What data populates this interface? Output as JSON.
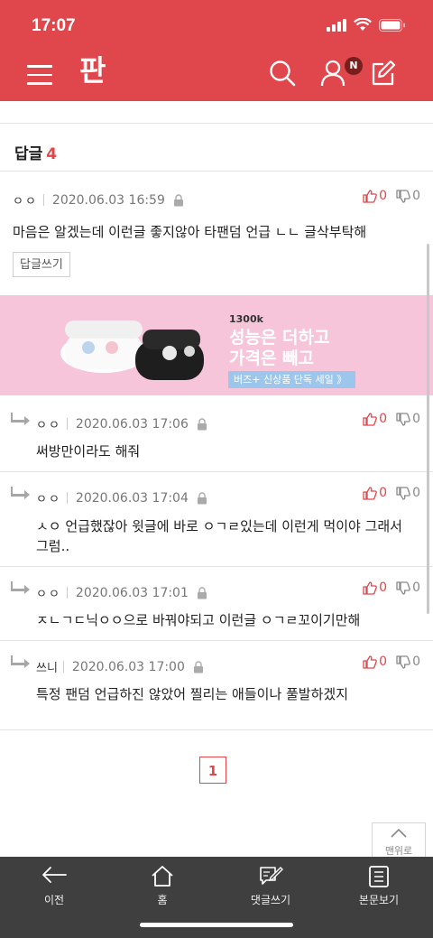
{
  "status": {
    "time": "17:07"
  },
  "header": {
    "logo": "판",
    "notification_badge": "N",
    "accent": "#e0474c"
  },
  "section": {
    "title": "답글",
    "count": "4"
  },
  "comment": {
    "author": "ㅇㅇ",
    "date": "2020.06.03 16:59",
    "likes": "0",
    "dislikes": "0",
    "text": "마음은 알겠는데 이런글 좋지않아 타팬덤 언급 ㄴㄴ 글삭부탁해",
    "reply_button": "답글쓰기"
  },
  "ad": {
    "brand": "1300k",
    "headline_line1": "성능은 더하고",
    "headline_line2": "가격은 빼고",
    "tag": "버즈+ 신상품 단독 세일 》"
  },
  "replies": [
    {
      "author": "ㅇㅇ",
      "date": "2020.06.03 17:06",
      "likes": "0",
      "dislikes": "0",
      "text": "써방만이라도 해줘"
    },
    {
      "author": "ㅇㅇ",
      "date": "2020.06.03 17:04",
      "likes": "0",
      "dislikes": "0",
      "text": "ㅅㅇ 언급했잖아 윗글에 바로 ㅇㄱㄹ있는데 이런게 먹이야 그래서 그럼.."
    },
    {
      "author": "ㅇㅇ",
      "date": "2020.06.03 17:01",
      "likes": "0",
      "dislikes": "0",
      "text": "ㅈㄴㄱㄷ닉ㅇㅇ으로 바꿔야되고 이런글 ㅇㄱㄹ꼬이기만해"
    },
    {
      "author": "쓰니",
      "date": "2020.06.03 17:00",
      "likes": "0",
      "dislikes": "0",
      "text": "특정 팬덤 언급하진 않았어 찔리는 애들이나 풀발하겠지"
    }
  ],
  "pagination": {
    "current": "1"
  },
  "to_top": {
    "label": "맨위로"
  },
  "bottom_nav": [
    {
      "label": "이전",
      "icon": "back-arrow-icon"
    },
    {
      "label": "홈",
      "icon": "home-icon"
    },
    {
      "label": "댓글쓰기",
      "icon": "write-comment-icon"
    },
    {
      "label": "본문보기",
      "icon": "document-icon"
    }
  ]
}
